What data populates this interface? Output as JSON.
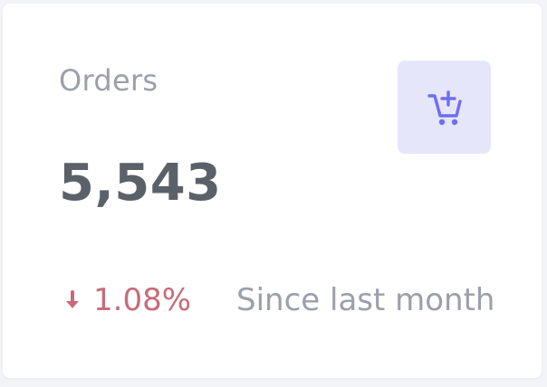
{
  "card": {
    "title": "Orders",
    "value": "5,543",
    "icon": "cart-plus-icon",
    "trend": {
      "direction": "down",
      "icon": "arrow-down-icon",
      "value": "1.08%",
      "color": "#c86b78"
    },
    "comparison_text": "Since last month"
  },
  "colors": {
    "card_background": "#ffffff",
    "page_background": "#f3f4f7",
    "icon_background": "#e6e6fb",
    "icon_color": "#6f6df2",
    "muted_text": "#9aa0a9",
    "value_text": "#5b6169"
  }
}
